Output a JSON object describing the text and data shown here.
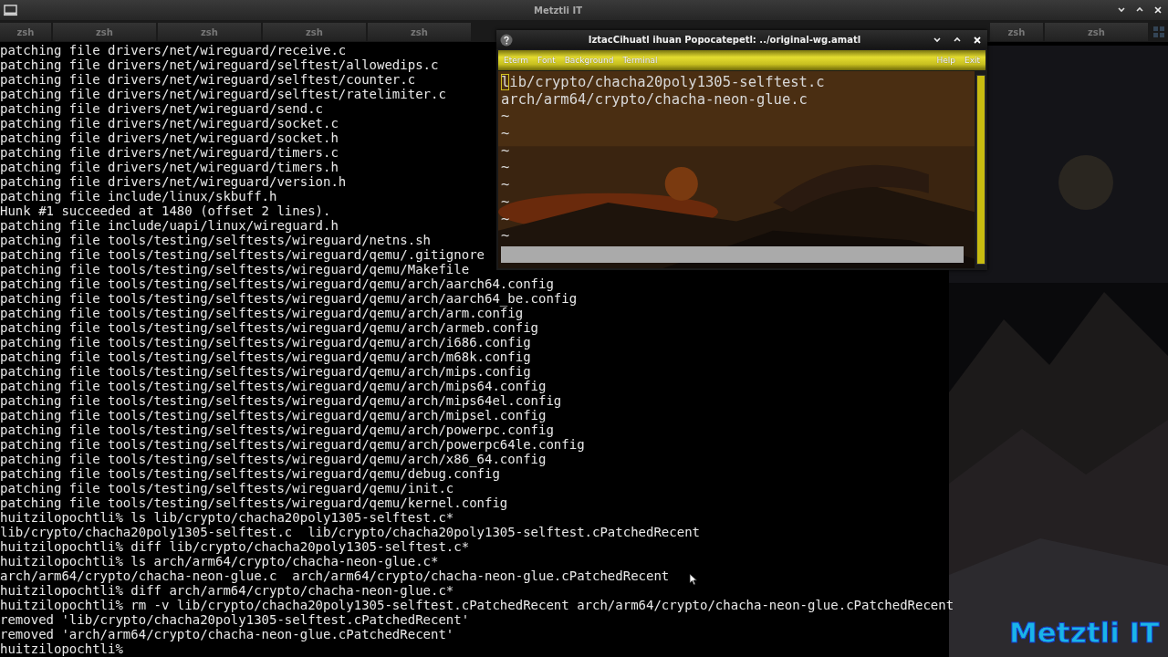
{
  "window": {
    "title": "Metztli IT"
  },
  "tabs_left": [
    {
      "label": "zsh",
      "selected": false
    },
    {
      "label": "zsh",
      "selected": false
    },
    {
      "label": "zsh",
      "selected": false
    },
    {
      "label": "zsh",
      "selected": false
    },
    {
      "label": "zsh",
      "selected": false
    }
  ],
  "tabs_right": [
    {
      "label": "zsh",
      "selected": false
    },
    {
      "label": "zsh",
      "selected": false
    }
  ],
  "terminal": {
    "lines": [
      "patching file drivers/net/wireguard/receive.c",
      "patching file drivers/net/wireguard/selftest/allowedips.c",
      "patching file drivers/net/wireguard/selftest/counter.c",
      "patching file drivers/net/wireguard/selftest/ratelimiter.c",
      "patching file drivers/net/wireguard/send.c",
      "patching file drivers/net/wireguard/socket.c",
      "patching file drivers/net/wireguard/socket.h",
      "patching file drivers/net/wireguard/timers.c",
      "patching file drivers/net/wireguard/timers.h",
      "patching file drivers/net/wireguard/version.h",
      "patching file include/linux/skbuff.h",
      "Hunk #1 succeeded at 1480 (offset 2 lines).",
      "patching file include/uapi/linux/wireguard.h",
      "patching file tools/testing/selftests/wireguard/netns.sh",
      "patching file tools/testing/selftests/wireguard/qemu/.gitignore",
      "patching file tools/testing/selftests/wireguard/qemu/Makefile",
      "patching file tools/testing/selftests/wireguard/qemu/arch/aarch64.config",
      "patching file tools/testing/selftests/wireguard/qemu/arch/aarch64_be.config",
      "patching file tools/testing/selftests/wireguard/qemu/arch/arm.config",
      "patching file tools/testing/selftests/wireguard/qemu/arch/armeb.config",
      "patching file tools/testing/selftests/wireguard/qemu/arch/i686.config",
      "patching file tools/testing/selftests/wireguard/qemu/arch/m68k.config",
      "patching file tools/testing/selftests/wireguard/qemu/arch/mips.config",
      "patching file tools/testing/selftests/wireguard/qemu/arch/mips64.config",
      "patching file tools/testing/selftests/wireguard/qemu/arch/mips64el.config",
      "patching file tools/testing/selftests/wireguard/qemu/arch/mipsel.config",
      "patching file tools/testing/selftests/wireguard/qemu/arch/powerpc.config",
      "patching file tools/testing/selftests/wireguard/qemu/arch/powerpc64le.config",
      "patching file tools/testing/selftests/wireguard/qemu/arch/x86_64.config",
      "patching file tools/testing/selftests/wireguard/qemu/debug.config",
      "patching file tools/testing/selftests/wireguard/qemu/init.c",
      "patching file tools/testing/selftests/wireguard/qemu/kernel.config",
      "huitzilopochtli% ls lib/crypto/chacha20poly1305-selftest.c*",
      "lib/crypto/chacha20poly1305-selftest.c  lib/crypto/chacha20poly1305-selftest.cPatchedRecent",
      "huitzilopochtli% diff lib/crypto/chacha20poly1305-selftest.c*",
      "huitzilopochtli% ls arch/arm64/crypto/chacha-neon-glue.c*",
      "arch/arm64/crypto/chacha-neon-glue.c  arch/arm64/crypto/chacha-neon-glue.cPatchedRecent",
      "huitzilopochtli% diff arch/arm64/crypto/chacha-neon-glue.c*",
      "huitzilopochtli% rm -v lib/crypto/chacha20poly1305-selftest.cPatchedRecent arch/arm64/crypto/chacha-neon-glue.cPatchedRecent",
      "removed 'lib/crypto/chacha20poly1305-selftest.cPatchedRecent'",
      "removed 'arch/arm64/crypto/chacha-neon-glue.cPatchedRecent'",
      "huitzilopochtli%"
    ]
  },
  "eterm": {
    "title": "IztacCihuatl ihuan Popocatepetl: ../original-wg.amatl",
    "menu_left": [
      "Eterm",
      "Font",
      "Background",
      "Terminal"
    ],
    "menu_right": [
      "Help",
      "Exit"
    ],
    "lines": [
      {
        "text": "lib/crypto/chacha20poly1305-selftest.c",
        "cursor": true
      },
      {
        "text": "arch/arm64/crypto/chacha-neon-glue.c",
        "cursor": false
      },
      {
        "text": "~",
        "cursor": false
      },
      {
        "text": "~",
        "cursor": false
      },
      {
        "text": "~",
        "cursor": false
      },
      {
        "text": "~",
        "cursor": false
      },
      {
        "text": "~",
        "cursor": false
      },
      {
        "text": "~",
        "cursor": false
      },
      {
        "text": "~",
        "cursor": false
      },
      {
        "text": "~",
        "cursor": false
      }
    ]
  },
  "wallpaper_logo": "Metztli IT"
}
